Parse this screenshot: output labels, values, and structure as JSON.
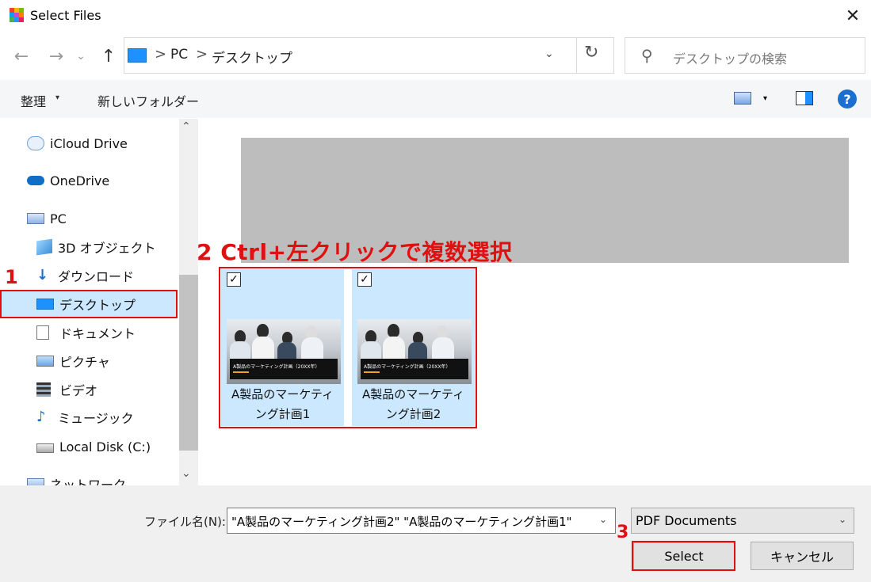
{
  "window": {
    "title": "Select Files",
    "close_glyph": "✕"
  },
  "nav": {
    "back_glyph": "←",
    "forward_glyph": "→",
    "recent_glyph": "⌄",
    "up_glyph": "↑",
    "breadcrumb": [
      "PC",
      "デスクトップ"
    ],
    "separator": ">",
    "dropdown_glyph": "⌄",
    "refresh_glyph": "↻",
    "search_placeholder": "デスクトップの検索"
  },
  "toolbar": {
    "organize_label": "整理",
    "organize_caret": "▾",
    "new_folder_label": "新しいフォルダー",
    "view_caret": "▾",
    "help_label": "?"
  },
  "sidebar": {
    "items": [
      {
        "label": "iCloud Drive",
        "icon": "icloud-icon"
      },
      {
        "label": "OneDrive",
        "icon": "onedrive-icon"
      },
      {
        "label": "PC",
        "icon": "pc-icon"
      },
      {
        "label": "3D オブジェクト",
        "icon": "3d-objects-icon"
      },
      {
        "label": "ダウンロード",
        "icon": "download-icon"
      },
      {
        "label": "デスクトップ",
        "icon": "desktop-icon",
        "selected": true
      },
      {
        "label": "ドキュメント",
        "icon": "documents-icon"
      },
      {
        "label": "ピクチャ",
        "icon": "pictures-icon"
      },
      {
        "label": "ビデオ",
        "icon": "videos-icon"
      },
      {
        "label": "ミュージック",
        "icon": "music-icon"
      },
      {
        "label": "Local Disk (C:)",
        "icon": "local-disk-icon"
      },
      {
        "label": "ネットワーク",
        "icon": "network-icon"
      }
    ],
    "scroll_up_glyph": "⌃",
    "scroll_down_glyph": "⌄"
  },
  "files": [
    {
      "name_line1": "A製品のマーケティ",
      "name_line2": "ング計画1",
      "thumb_title": "A製品のマーケティング計画（20XX年）",
      "checked": true
    },
    {
      "name_line1": "A製品のマーケティ",
      "name_line2": "ング計画2",
      "thumb_title": "A製品のマーケティング計画（20XX年）",
      "checked": true
    }
  ],
  "bottom": {
    "filename_label": "ファイル名(N):",
    "filename_value": "\"A製品のマーケティング計画2\" \"A製品のマーケティング計画1\"",
    "filetype_value": "PDF Documents",
    "caret_glyph": "⌄",
    "select_label": "Select",
    "cancel_label": "キャンセル"
  },
  "annotations": {
    "step1": "1",
    "step2": "2 Ctrl+左クリックで複数選択",
    "step3": "3"
  },
  "colors": {
    "accent_red": "#e01010",
    "selection": "#cce8ff",
    "sidebar_selected": "#cce8ff"
  }
}
